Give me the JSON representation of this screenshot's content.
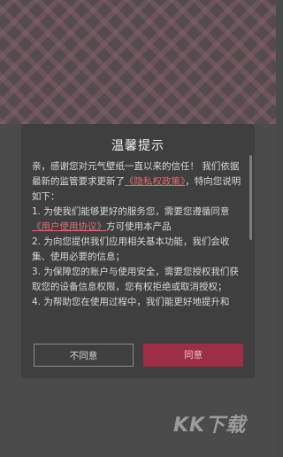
{
  "dialog": {
    "title": "温馨提示",
    "intro": "亲，感谢您对元气壁纸一直以来的信任！ 我们依据最新的监管要求更新了",
    "privacy_link": "《隐私权政策》",
    "intro_tail": "，特向您说明如下：",
    "item1_head": "1. 为使我们能够更好的服务您，需要您遵循同意",
    "user_link": "《用户使用协议》",
    "item1_tail": "方可使用本产品",
    "item2": "2. 为向您提供我们应用相关基本功能，我们会收集、使用必要的信息；",
    "item3": "3. 为保障您的账户与使用安全，需要您授权我们获取您的设备信息权限，您有权拒绝或取消授权；",
    "item4": "4. 为帮助您在使用过程中，我们能更好地提升和",
    "disagree_label": "不同意",
    "agree_label": "同意"
  },
  "watermark": "KK下载",
  "colors": {
    "agree_button": "#9c2f45",
    "link": "#e56b73"
  }
}
